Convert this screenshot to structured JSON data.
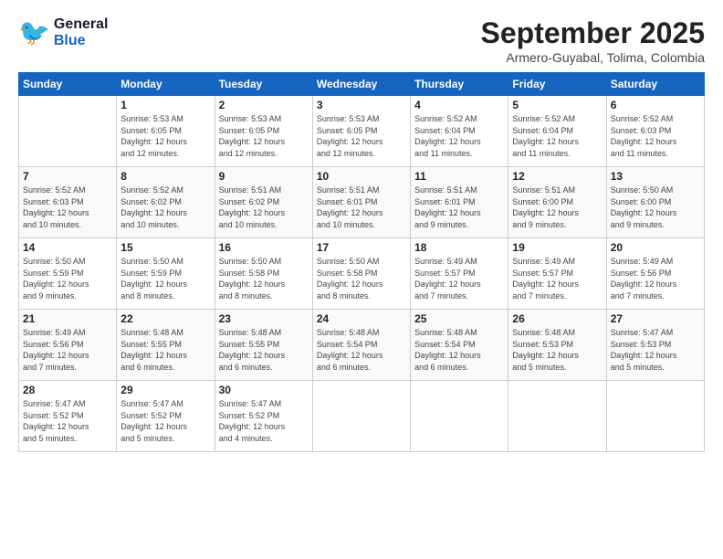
{
  "logo": {
    "line1": "General",
    "line2": "Blue"
  },
  "title": "September 2025",
  "subtitle": "Armero-Guyabal, Tolima, Colombia",
  "days_of_week": [
    "Sunday",
    "Monday",
    "Tuesday",
    "Wednesday",
    "Thursday",
    "Friday",
    "Saturday"
  ],
  "weeks": [
    [
      {
        "day": "",
        "info": ""
      },
      {
        "day": "1",
        "info": "Sunrise: 5:53 AM\nSunset: 6:05 PM\nDaylight: 12 hours\nand 12 minutes."
      },
      {
        "day": "2",
        "info": "Sunrise: 5:53 AM\nSunset: 6:05 PM\nDaylight: 12 hours\nand 12 minutes."
      },
      {
        "day": "3",
        "info": "Sunrise: 5:53 AM\nSunset: 6:05 PM\nDaylight: 12 hours\nand 12 minutes."
      },
      {
        "day": "4",
        "info": "Sunrise: 5:52 AM\nSunset: 6:04 PM\nDaylight: 12 hours\nand 11 minutes."
      },
      {
        "day": "5",
        "info": "Sunrise: 5:52 AM\nSunset: 6:04 PM\nDaylight: 12 hours\nand 11 minutes."
      },
      {
        "day": "6",
        "info": "Sunrise: 5:52 AM\nSunset: 6:03 PM\nDaylight: 12 hours\nand 11 minutes."
      }
    ],
    [
      {
        "day": "7",
        "info": "Sunrise: 5:52 AM\nSunset: 6:03 PM\nDaylight: 12 hours\nand 10 minutes."
      },
      {
        "day": "8",
        "info": "Sunrise: 5:52 AM\nSunset: 6:02 PM\nDaylight: 12 hours\nand 10 minutes."
      },
      {
        "day": "9",
        "info": "Sunrise: 5:51 AM\nSunset: 6:02 PM\nDaylight: 12 hours\nand 10 minutes."
      },
      {
        "day": "10",
        "info": "Sunrise: 5:51 AM\nSunset: 6:01 PM\nDaylight: 12 hours\nand 10 minutes."
      },
      {
        "day": "11",
        "info": "Sunrise: 5:51 AM\nSunset: 6:01 PM\nDaylight: 12 hours\nand 9 minutes."
      },
      {
        "day": "12",
        "info": "Sunrise: 5:51 AM\nSunset: 6:00 PM\nDaylight: 12 hours\nand 9 minutes."
      },
      {
        "day": "13",
        "info": "Sunrise: 5:50 AM\nSunset: 6:00 PM\nDaylight: 12 hours\nand 9 minutes."
      }
    ],
    [
      {
        "day": "14",
        "info": "Sunrise: 5:50 AM\nSunset: 5:59 PM\nDaylight: 12 hours\nand 9 minutes."
      },
      {
        "day": "15",
        "info": "Sunrise: 5:50 AM\nSunset: 5:59 PM\nDaylight: 12 hours\nand 8 minutes."
      },
      {
        "day": "16",
        "info": "Sunrise: 5:50 AM\nSunset: 5:58 PM\nDaylight: 12 hours\nand 8 minutes."
      },
      {
        "day": "17",
        "info": "Sunrise: 5:50 AM\nSunset: 5:58 PM\nDaylight: 12 hours\nand 8 minutes."
      },
      {
        "day": "18",
        "info": "Sunrise: 5:49 AM\nSunset: 5:57 PM\nDaylight: 12 hours\nand 7 minutes."
      },
      {
        "day": "19",
        "info": "Sunrise: 5:49 AM\nSunset: 5:57 PM\nDaylight: 12 hours\nand 7 minutes."
      },
      {
        "day": "20",
        "info": "Sunrise: 5:49 AM\nSunset: 5:56 PM\nDaylight: 12 hours\nand 7 minutes."
      }
    ],
    [
      {
        "day": "21",
        "info": "Sunrise: 5:49 AM\nSunset: 5:56 PM\nDaylight: 12 hours\nand 7 minutes."
      },
      {
        "day": "22",
        "info": "Sunrise: 5:48 AM\nSunset: 5:55 PM\nDaylight: 12 hours\nand 6 minutes."
      },
      {
        "day": "23",
        "info": "Sunrise: 5:48 AM\nSunset: 5:55 PM\nDaylight: 12 hours\nand 6 minutes."
      },
      {
        "day": "24",
        "info": "Sunrise: 5:48 AM\nSunset: 5:54 PM\nDaylight: 12 hours\nand 6 minutes."
      },
      {
        "day": "25",
        "info": "Sunrise: 5:48 AM\nSunset: 5:54 PM\nDaylight: 12 hours\nand 6 minutes."
      },
      {
        "day": "26",
        "info": "Sunrise: 5:48 AM\nSunset: 5:53 PM\nDaylight: 12 hours\nand 5 minutes."
      },
      {
        "day": "27",
        "info": "Sunrise: 5:47 AM\nSunset: 5:53 PM\nDaylight: 12 hours\nand 5 minutes."
      }
    ],
    [
      {
        "day": "28",
        "info": "Sunrise: 5:47 AM\nSunset: 5:52 PM\nDaylight: 12 hours\nand 5 minutes."
      },
      {
        "day": "29",
        "info": "Sunrise: 5:47 AM\nSunset: 5:52 PM\nDaylight: 12 hours\nand 5 minutes."
      },
      {
        "day": "30",
        "info": "Sunrise: 5:47 AM\nSunset: 5:52 PM\nDaylight: 12 hours\nand 4 minutes."
      },
      {
        "day": "",
        "info": ""
      },
      {
        "day": "",
        "info": ""
      },
      {
        "day": "",
        "info": ""
      },
      {
        "day": "",
        "info": ""
      }
    ]
  ]
}
